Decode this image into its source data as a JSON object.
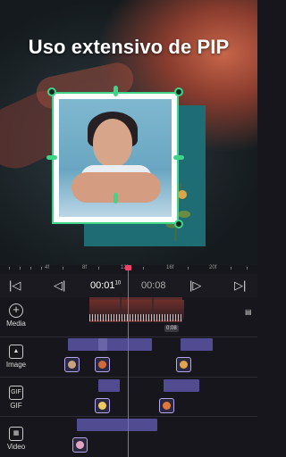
{
  "headline": "Uso extensivo de PIP",
  "ruler": {
    "labels": [
      "4f",
      "8f",
      "12f",
      "16f",
      "20f"
    ]
  },
  "controls": {
    "go_start": "|◁",
    "prev_frame": "◁|",
    "current_time": "00:01",
    "current_frame": "10",
    "total_time": "00:08",
    "next_frame": "|▷",
    "go_end": "▷|"
  },
  "tracks": {
    "media_label": "Media",
    "image_label": "Image",
    "gif_label": "GIF",
    "video_label": "Video",
    "gif_icon_text": "GIF"
  },
  "main_clip": {
    "duration_badge": "0:08"
  },
  "colors": {
    "accent": "#3fd48a",
    "playhead": "#f0436a",
    "clip": "#514c92",
    "thumb_border": "#b7a7f2"
  }
}
